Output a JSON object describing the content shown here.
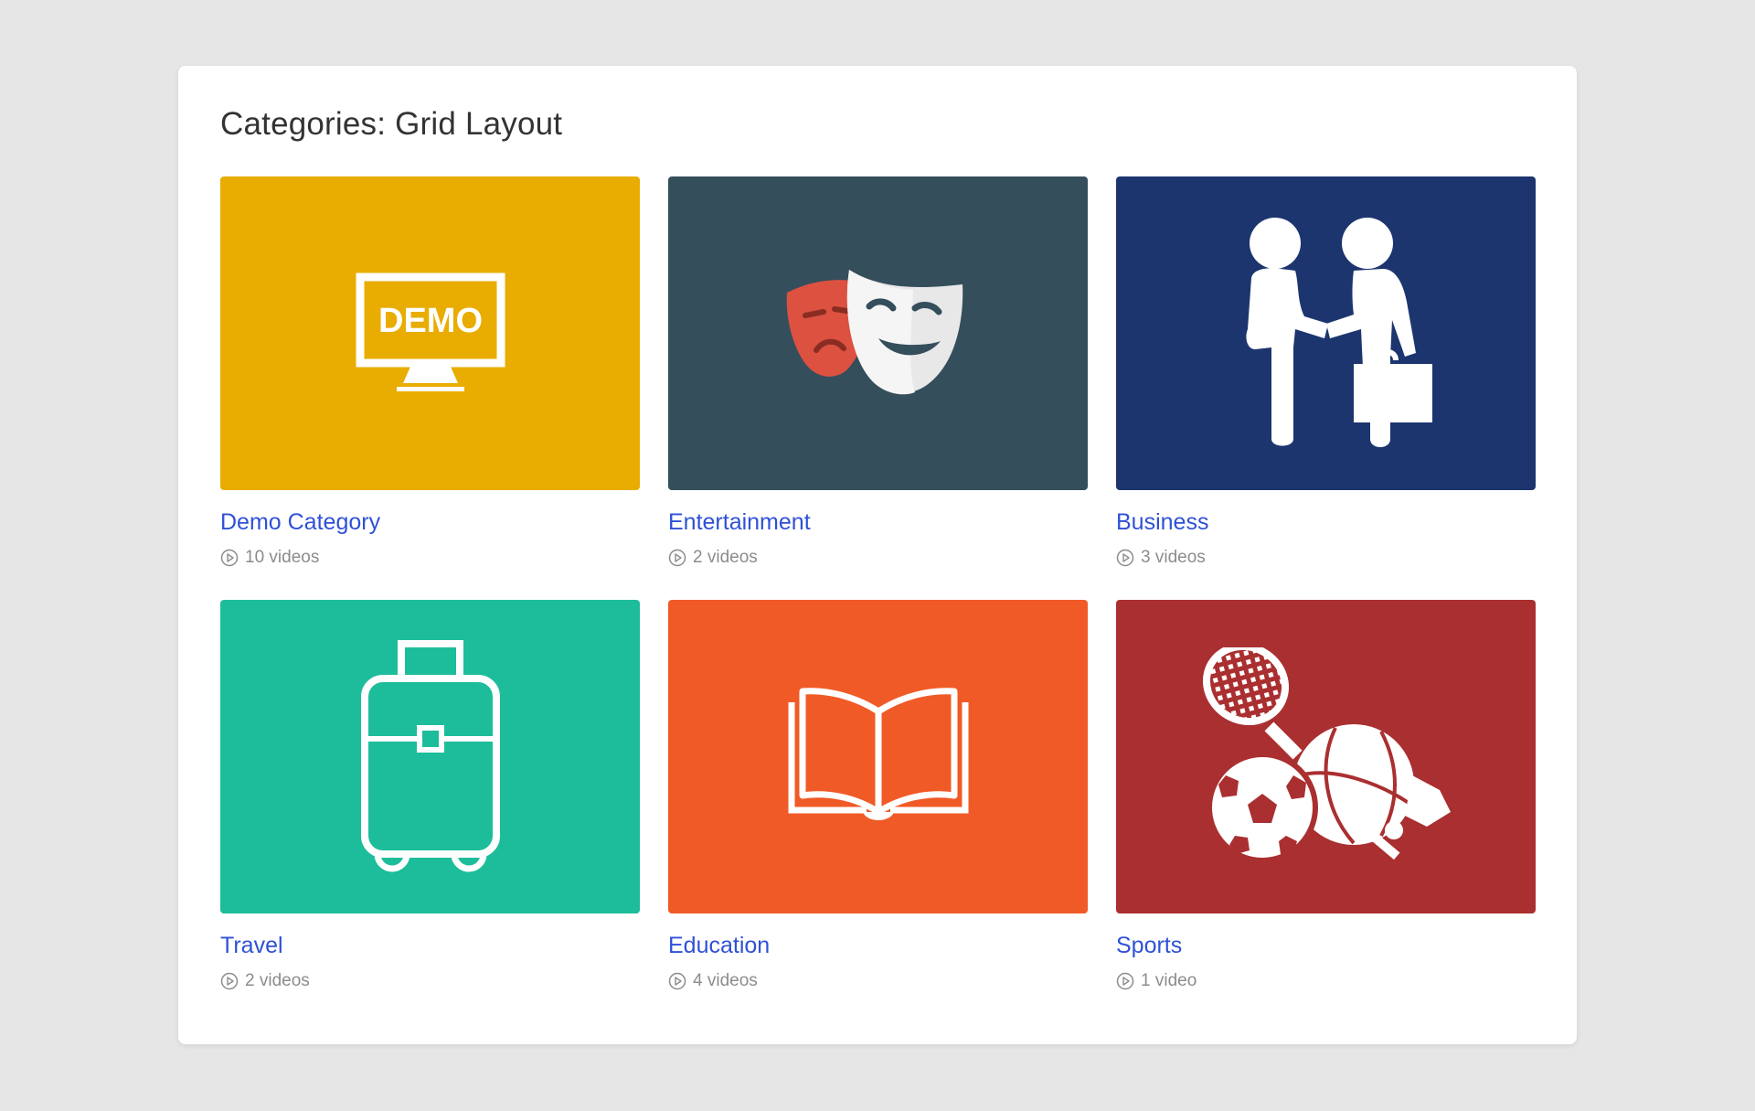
{
  "page": {
    "title": "Categories: Grid Layout"
  },
  "colors": {
    "background": "#e6e6e6",
    "card": "#ffffff",
    "link": "#2f51d6",
    "meta": "#8c8c8c"
  },
  "categories": [
    {
      "name": "Demo Category",
      "count_label": "10 videos",
      "color": "#e9ac00",
      "icon": "demo-monitor-icon",
      "icon_text": "DEMO"
    },
    {
      "name": "Entertainment",
      "count_label": "2 videos",
      "color": "#344e5c",
      "icon": "theater-masks-icon"
    },
    {
      "name": "Business",
      "count_label": "3 videos",
      "color": "#1c356f",
      "icon": "handshake-icon"
    },
    {
      "name": "Travel",
      "count_label": "2 videos",
      "color": "#1dbd9b",
      "icon": "suitcase-icon"
    },
    {
      "name": "Education",
      "count_label": "4 videos",
      "color": "#f05a27",
      "icon": "open-book-icon"
    },
    {
      "name": "Sports",
      "count_label": "1 video",
      "color": "#aa2f30",
      "icon": "sports-equipment-icon"
    }
  ]
}
